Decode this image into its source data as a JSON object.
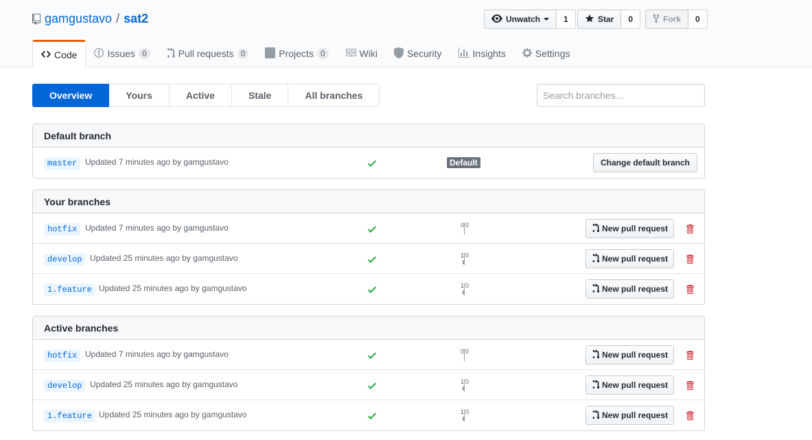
{
  "repo": {
    "owner": "gamgustavo",
    "separator": "/",
    "name": "sat2"
  },
  "actions": {
    "watch": {
      "label": "Unwatch",
      "count": "1"
    },
    "star": {
      "label": "Star",
      "count": "0"
    },
    "fork": {
      "label": "Fork",
      "count": "0"
    }
  },
  "tabs": [
    {
      "label": "Code",
      "icon": "code-icon",
      "selected": true
    },
    {
      "label": "Issues",
      "icon": "issue-icon",
      "count": "0"
    },
    {
      "label": "Pull requests",
      "icon": "git-pull-request-icon",
      "count": "0"
    },
    {
      "label": "Projects",
      "icon": "project-icon",
      "count": "0"
    },
    {
      "label": "Wiki",
      "icon": "book-icon"
    },
    {
      "label": "Security",
      "icon": "shield-icon"
    },
    {
      "label": "Insights",
      "icon": "graph-icon"
    },
    {
      "label": "Settings",
      "icon": "gear-icon"
    }
  ],
  "subnav": [
    "Overview",
    "Yours",
    "Active",
    "Stale",
    "All branches"
  ],
  "search": {
    "placeholder": "Search branches..."
  },
  "default_section": {
    "title": "Default branch",
    "branch": "master",
    "updated": "Updated 7 minutes ago by gamgustavo",
    "label": "Default",
    "change_button": "Change default branch"
  },
  "your_section": {
    "title": "Your branches",
    "rows": [
      {
        "name": "hotfix",
        "updated": "Updated 7 minutes ago by gamgustavo",
        "behind": "0",
        "ahead": "0"
      },
      {
        "name": "develop",
        "updated": "Updated 25 minutes ago by gamgustavo",
        "behind": "1",
        "ahead": "0"
      },
      {
        "name": "1.feature",
        "updated": "Updated 25 minutes ago by gamgustavo",
        "behind": "1",
        "ahead": "0"
      }
    ]
  },
  "active_section": {
    "title": "Active branches",
    "rows": [
      {
        "name": "hotfix",
        "updated": "Updated 7 minutes ago by gamgustavo",
        "behind": "0",
        "ahead": "0"
      },
      {
        "name": "develop",
        "updated": "Updated 25 minutes ago by gamgustavo",
        "behind": "1",
        "ahead": "0"
      },
      {
        "name": "1.feature",
        "updated": "Updated 25 minutes ago by gamgustavo",
        "behind": "1",
        "ahead": "0"
      }
    ]
  },
  "pr_button_label": "New pull request",
  "colors": {
    "link": "#0366d6",
    "success": "#28a745",
    "danger": "#cb2431",
    "selected_tab_border": "#e36209"
  }
}
